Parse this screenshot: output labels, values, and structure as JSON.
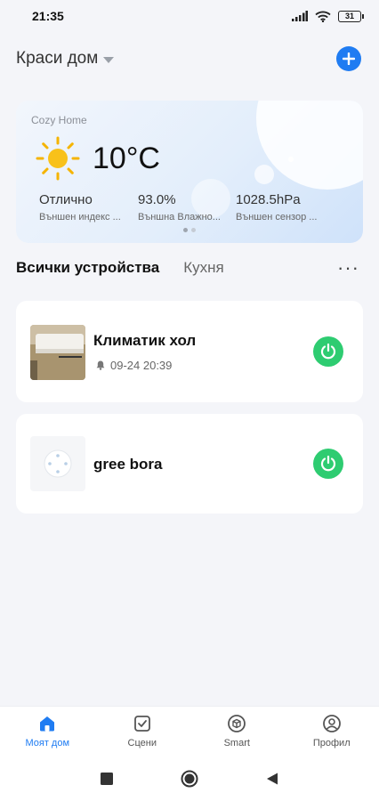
{
  "status_bar": {
    "time": "21:35",
    "battery": "31"
  },
  "header": {
    "home_name": "Краси дом"
  },
  "weather": {
    "location": "Cozy Home",
    "temperature": "10°C",
    "stats": [
      {
        "value": "Отлично",
        "label": "Външен индекс ..."
      },
      {
        "value": "93.0%",
        "label": "Външна Влажно..."
      },
      {
        "value": "1028.5hPa",
        "label": "Външен сензор ..."
      }
    ]
  },
  "tabs": {
    "all": "Всички устройства",
    "kitchen": "Кухня",
    "more": "···"
  },
  "devices": [
    {
      "name": "Климатик хол",
      "timestamp": "09-24 20:39"
    },
    {
      "name": "gree bora"
    }
  ],
  "bottom_nav": [
    {
      "label": "Моят дом"
    },
    {
      "label": "Сцени"
    },
    {
      "label": "Smart"
    },
    {
      "label": "Профил"
    }
  ],
  "colors": {
    "accent": "#1f7cf2",
    "power_on": "#2ecc71"
  }
}
